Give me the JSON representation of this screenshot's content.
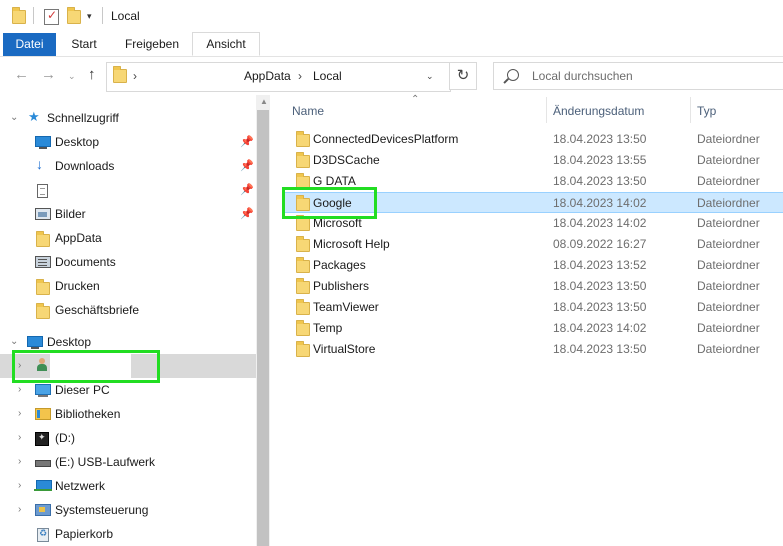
{
  "window": {
    "title": "Local"
  },
  "ribbon": {
    "tabs": [
      {
        "label": "Datei"
      },
      {
        "label": "Start"
      },
      {
        "label": "Freigeben"
      },
      {
        "label": "Ansicht"
      }
    ]
  },
  "nav": {
    "back_icon": "arrow-left-icon",
    "forward_icon": "arrow-right-icon",
    "recent_icon": "chevron-down-icon",
    "up_icon": "arrow-up-icon",
    "breadcrumb": [
      "AppData",
      "Local"
    ],
    "breadcrumb_sep": "›",
    "refresh_icon": "refresh-icon"
  },
  "search": {
    "placeholder": "Local durchsuchen"
  },
  "sidebar": {
    "items": [
      {
        "label": "Schnellzugriff",
        "icon": "star-icon",
        "expander": "⌄",
        "pinned": false
      },
      {
        "label": "Desktop",
        "icon": "monitor-icon",
        "expander": "",
        "pinned": true
      },
      {
        "label": "Downloads",
        "icon": "download-icon",
        "expander": "",
        "pinned": true
      },
      {
        "label": "",
        "icon": "document-icon",
        "expander": "",
        "pinned": true
      },
      {
        "label": "Bilder",
        "icon": "pictures-icon",
        "expander": "",
        "pinned": true
      },
      {
        "label": "AppData",
        "icon": "folder-icon",
        "expander": "",
        "pinned": false
      },
      {
        "label": "Documents",
        "icon": "documents-icon",
        "expander": "",
        "pinned": false
      },
      {
        "label": "Drucken",
        "icon": "folder-icon",
        "expander": "",
        "pinned": false
      },
      {
        "label": "Geschäftsbriefe",
        "icon": "folder-icon",
        "expander": "",
        "pinned": false
      },
      {
        "label": "Desktop",
        "icon": "monitor-icon",
        "expander": "⌄",
        "pinned": false
      },
      {
        "label": "",
        "icon": "user-icon",
        "expander": "›",
        "pinned": false
      },
      {
        "label": "Dieser PC",
        "icon": "computer-icon",
        "expander": "›",
        "pinned": false
      },
      {
        "label": "Bibliotheken",
        "icon": "libraries-icon",
        "expander": "›",
        "pinned": false
      },
      {
        "label": "(D:)",
        "icon": "drive-icon",
        "expander": "›",
        "pinned": false
      },
      {
        "label": "(E:) USB-Laufwerk",
        "icon": "usb-drive-icon",
        "expander": "›",
        "pinned": false
      },
      {
        "label": "Netzwerk",
        "icon": "network-icon",
        "expander": "›",
        "pinned": false
      },
      {
        "label": "Systemsteuerung",
        "icon": "control-panel-icon",
        "expander": "›",
        "pinned": false
      },
      {
        "label": "Papierkorb",
        "icon": "recycle-bin-icon",
        "expander": "",
        "pinned": false
      }
    ],
    "pin_glyph": "📌"
  },
  "filelist": {
    "sort_glyph": "⌃",
    "columns": {
      "name": "Name",
      "date": "Änderungsdatum",
      "type": "Typ"
    },
    "rows": [
      {
        "name": "ConnectedDevicesPlatform",
        "date": "18.04.2023 13:50",
        "type": "Dateiordner"
      },
      {
        "name": "D3DSCache",
        "date": "18.04.2023 13:55",
        "type": "Dateiordner"
      },
      {
        "name": "G DATA",
        "date": "18.04.2023 13:50",
        "type": "Dateiordner"
      },
      {
        "name": "Google",
        "date": "18.04.2023 14:02",
        "type": "Dateiordner"
      },
      {
        "name": "Microsoft",
        "date": "18.04.2023 14:02",
        "type": "Dateiordner"
      },
      {
        "name": "Microsoft Help",
        "date": "08.09.2022 16:27",
        "type": "Dateiordner"
      },
      {
        "name": "Packages",
        "date": "18.04.2023 13:52",
        "type": "Dateiordner"
      },
      {
        "name": "Publishers",
        "date": "18.04.2023 13:50",
        "type": "Dateiordner"
      },
      {
        "name": "TeamViewer",
        "date": "18.04.2023 13:50",
        "type": "Dateiordner"
      },
      {
        "name": "Temp",
        "date": "18.04.2023 14:02",
        "type": "Dateiordner"
      },
      {
        "name": "VirtualStore",
        "date": "18.04.2023 13:50",
        "type": "Dateiordner"
      }
    ]
  },
  "colors": {
    "file_tab": "#1a6ac2",
    "row_selected": "#cce8ff",
    "highlight": "#22dd22",
    "folder": "#f7d775"
  }
}
